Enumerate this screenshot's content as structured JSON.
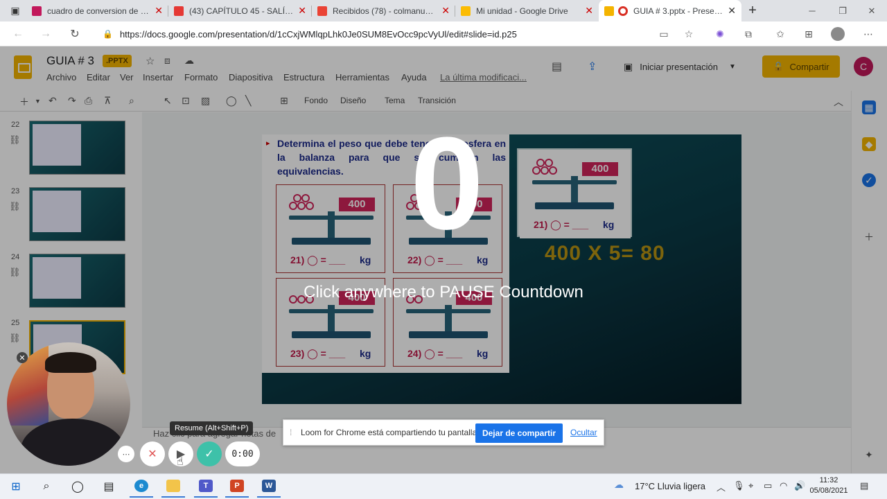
{
  "browser": {
    "tabs": [
      {
        "title": "cuadro de conversion de unid",
        "color": "#c2185b"
      },
      {
        "title": "(43) CAPÍTULO 45 - SALÍ DE M",
        "color": "#e53935"
      },
      {
        "title": "Recibidos (78) - colmanuelita",
        "color": "#ea4335"
      },
      {
        "title": "Mi unidad - Google Drive",
        "color": "#fbbc04"
      },
      {
        "title": "GUIA # 3.pptx - Presentac",
        "color": "#f4b400"
      }
    ],
    "new_tab": "+",
    "url": "https://docs.google.com/presentation/d/1cCxjWMlqpLhk0Je0SUM8EvOcc9pcVyUl/edit#slide=id.p25"
  },
  "slides": {
    "title": "GUIA # 3",
    "badge": ".PPTX",
    "menu": [
      "Archivo",
      "Editar",
      "Ver",
      "Insertar",
      "Formato",
      "Diapositiva",
      "Estructura",
      "Herramientas",
      "Ayuda"
    ],
    "last_modified": "La última modificaci...",
    "present_label": "Iniciar presentación",
    "share_label": "Compartir",
    "avatar_letter": "C",
    "toolbar": {
      "fondo": "Fondo",
      "diseno": "Diseño",
      "tema": "Tema",
      "transicion": "Transición"
    },
    "slide_numbers": [
      "22",
      "23",
      "24",
      "25"
    ],
    "notes_text": "Haz clic para agregar notas de"
  },
  "slide": {
    "question": "Determina el peso que debe tener cada esfera en la balanza para que se cumplan las equivalencias.",
    "weight": "400",
    "items": [
      {
        "label": "21) ◯ = ___",
        "unit": "kg"
      },
      {
        "label": "22) ◯ = ___",
        "unit": "kg"
      },
      {
        "label": "23) ◯ = ___",
        "unit": "kg"
      },
      {
        "label": "24) ◯ = ___",
        "unit": "kg"
      }
    ],
    "right_item": {
      "label": "21) ◯ = ___",
      "unit": "kg"
    },
    "formula": "400  X 5= 80"
  },
  "overlay": {
    "countdown": "0",
    "message": "Click anywhere to PAUSE Countdown"
  },
  "loom": {
    "tooltip": "Resume (Alt+Shift+P)",
    "timer": "0:00",
    "share_message": "Loom for Chrome está compartiendo tu pantalla.",
    "stop_share": "Dejar de compartir",
    "hide": "Ocultar"
  },
  "taskbar": {
    "weather": "17°C  Lluvia ligera",
    "time": "11:32",
    "date": "05/08/2021"
  }
}
